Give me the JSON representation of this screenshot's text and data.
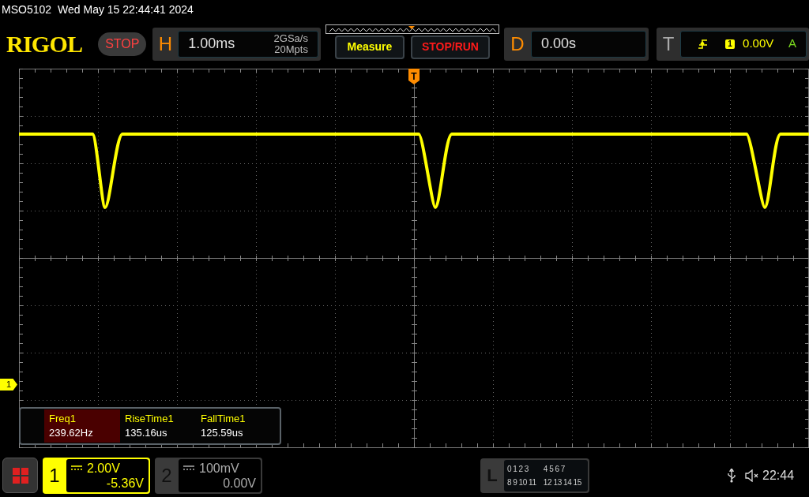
{
  "status_line": {
    "model": "MSO5102",
    "datetime": "Wed May 15 22:44:41 2024"
  },
  "brand": "RIGOL",
  "run_state": "STOP",
  "horizontal": {
    "label": "H",
    "timebase": "1.00ms",
    "sample_rate": "2GSa/s",
    "memory_depth": "20Mpts"
  },
  "buttons": [
    {
      "label": "Measure",
      "color": "#ffff00"
    },
    {
      "label": "STOP/RUN",
      "color": "#ff1a1a"
    }
  ],
  "delay": {
    "label": "D",
    "value": "0.00s"
  },
  "trigger": {
    "label": "T",
    "source": "1",
    "level": "0.00V",
    "mode": "A"
  },
  "trigger_marker": "T",
  "channel_marker": "1",
  "measurements": [
    {
      "name": "Freq1",
      "value": "239.62Hz",
      "selected": true
    },
    {
      "name": "RiseTime1",
      "value": "135.16us",
      "selected": false
    },
    {
      "name": "FallTime1",
      "value": "125.59us",
      "selected": false
    }
  ],
  "channels": [
    {
      "number": "1",
      "scale": "2.00V",
      "offset": "-5.36V",
      "selected": true
    },
    {
      "number": "2",
      "scale": "100mV",
      "offset": "0.00V",
      "selected": false
    }
  ],
  "logic": {
    "label": "L",
    "groups": [
      [
        "0",
        "1",
        "2",
        "3"
      ],
      [
        "4",
        "5",
        "6",
        "7"
      ],
      [
        "8",
        "9",
        "10",
        "11"
      ],
      [
        "12",
        "13",
        "14",
        "15"
      ]
    ]
  },
  "clock": "22:44"
}
